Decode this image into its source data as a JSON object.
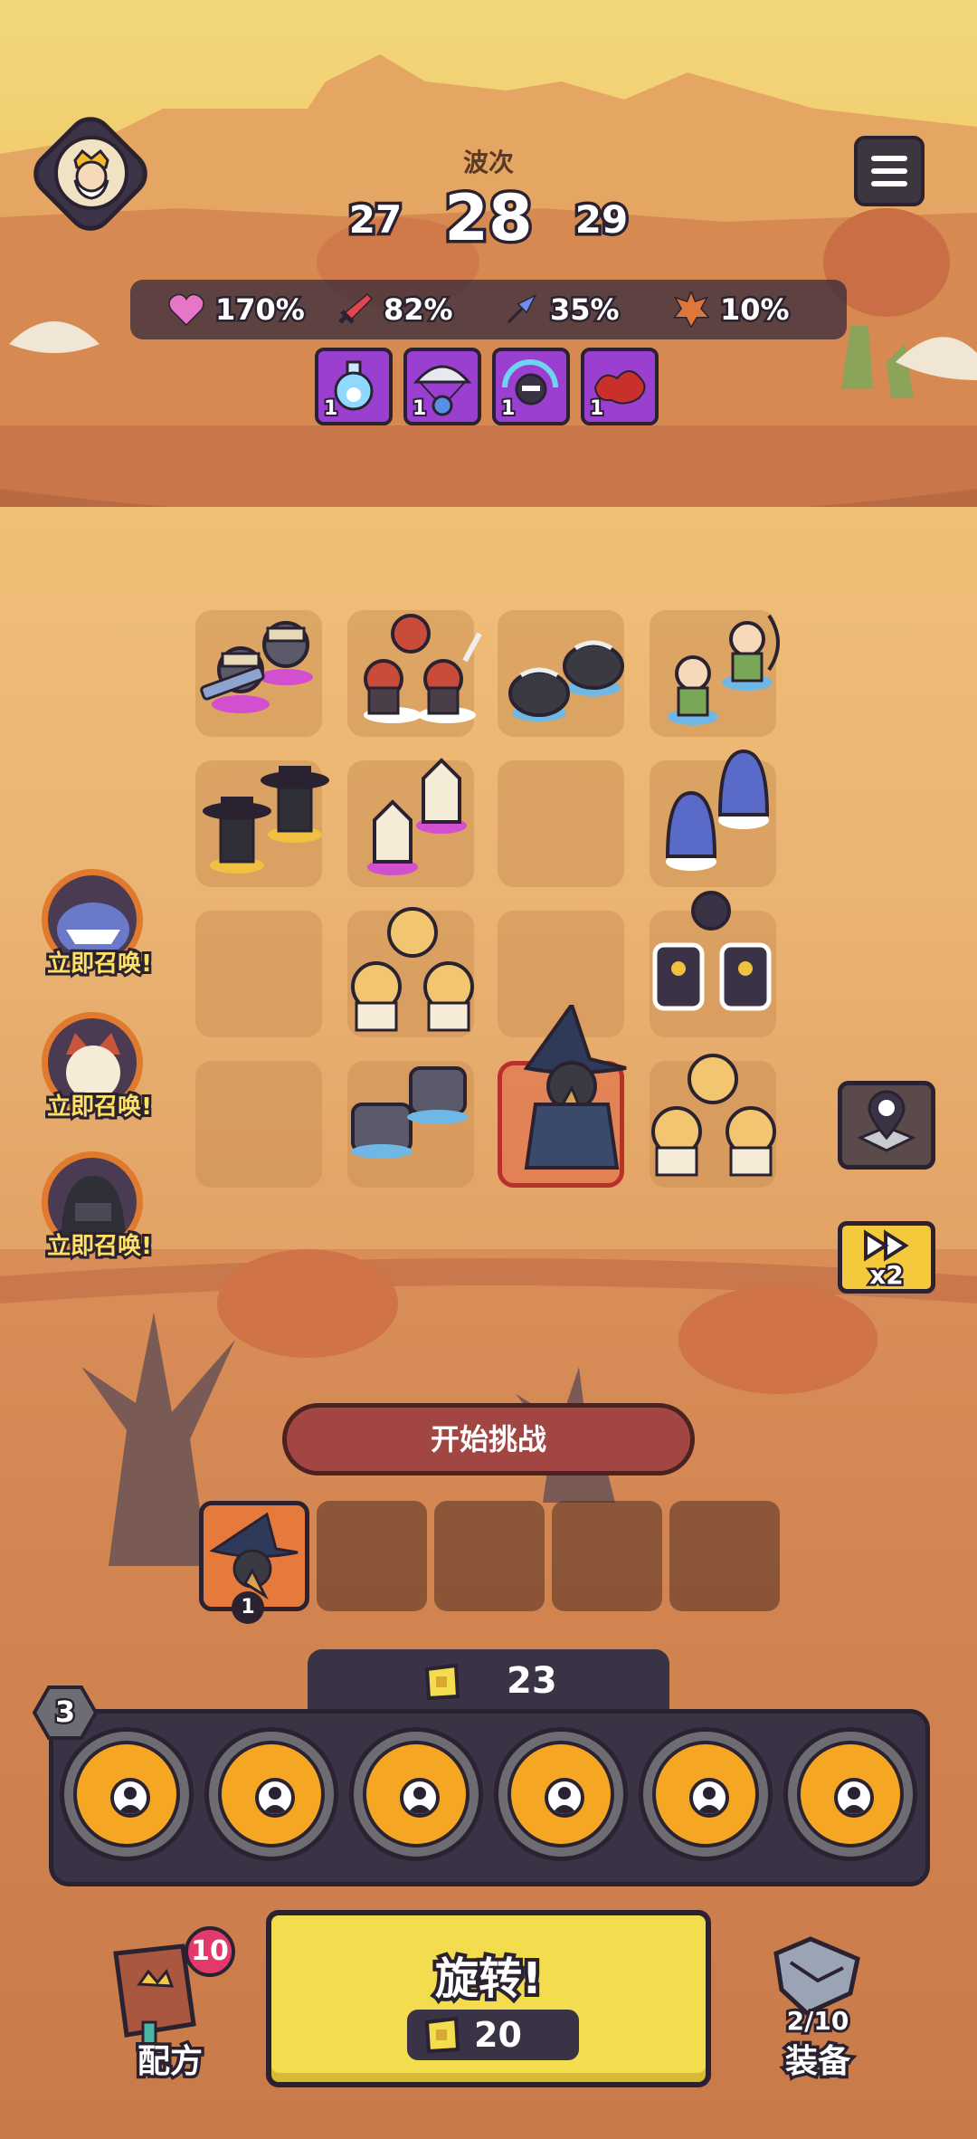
{
  "header": {
    "wave_label": "波次",
    "wave_prev": "27",
    "wave_current": "28",
    "wave_next": "29"
  },
  "stats": [
    {
      "icon": "heart-icon",
      "value": "170%",
      "color": "#e676c8"
    },
    {
      "icon": "sword-icon",
      "value": "82%",
      "color": "#e2454a"
    },
    {
      "icon": "speed-arrow-icon",
      "value": "35%",
      "color": "#6b8ff0"
    },
    {
      "icon": "critical-burst-icon",
      "value": "10%",
      "color": "#e0773a"
    }
  ],
  "buffs": [
    {
      "icon": "potion-icon",
      "count": "1"
    },
    {
      "icon": "parachute-icon",
      "count": "1"
    },
    {
      "icon": "ninja-icon",
      "count": "1"
    },
    {
      "icon": "blood-splat-icon",
      "count": "1"
    }
  ],
  "summons": [
    {
      "icon": "shark-monster-icon",
      "label": "立即召唤!"
    },
    {
      "icon": "cat-warrior-icon",
      "label": "立即召唤!"
    },
    {
      "icon": "hooded-knight-icon",
      "label": "立即召唤!"
    }
  ],
  "speed": {
    "label": "x2"
  },
  "challenge": {
    "label": "开始挑战"
  },
  "queue": {
    "first_count": "1"
  },
  "coins": {
    "value": "23"
  },
  "level": {
    "value": "3"
  },
  "spin": {
    "title": "旋转!",
    "cost": "20"
  },
  "recipe": {
    "label": "配方",
    "badge": "10"
  },
  "equipment": {
    "label": "装备",
    "progress": "2/10"
  },
  "colors": {
    "accent_yellow": "#f3dd4f",
    "panel_dark": "#3a3346",
    "slot_orange": "#f5a623",
    "challenge_red": "#a24643"
  }
}
